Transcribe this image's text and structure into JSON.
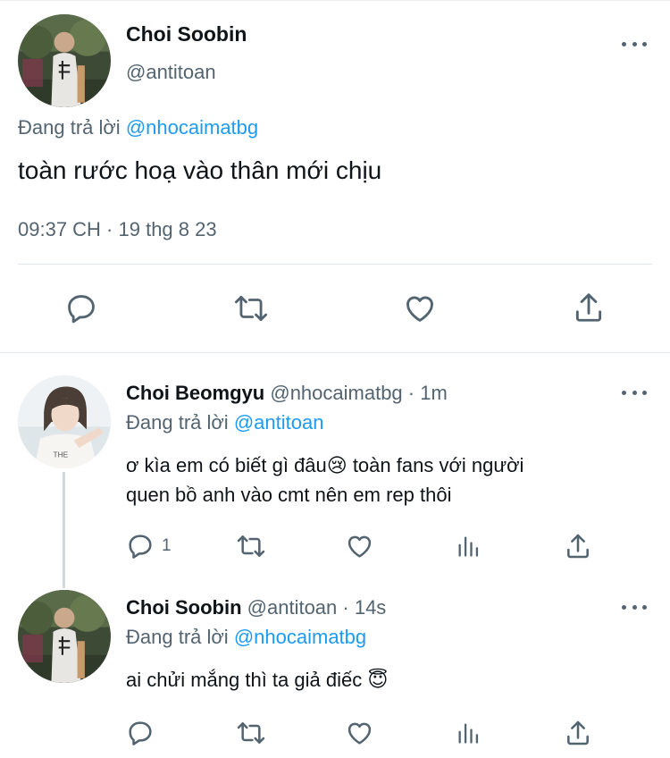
{
  "main_tweet": {
    "author_name": "Choi Soobin",
    "handle": "@antitoan",
    "reply_prefix": "Đang trả lời",
    "reply_to": "@nhocaimatbg",
    "text": "toàn rước hoạ vào thân mới chịu",
    "timestamp": "09:37 CH · 19 thg 8 23"
  },
  "replies": [
    {
      "author_name": "Choi Beomgyu",
      "meta": "@nhocaimatbg · 1m",
      "reply_prefix": "Đang trả lời",
      "reply_to": "@antitoan",
      "text_line1": "ơ kìa em có biết gì đâu😢  toàn fans với người",
      "text_line2": "quen bồ anh vào cmt nên em rep thôi",
      "reply_count": "1"
    },
    {
      "author_name": "Choi Soobin",
      "meta": "@antitoan · 14s",
      "reply_prefix": "Đang trả lời",
      "reply_to": "@nhocaimatbg",
      "text_line1": "ai chửi mắng thì ta giả điếc 😇"
    }
  ],
  "colors": {
    "text": "#0f1419",
    "muted": "#536471",
    "link": "#1d9bf0",
    "divider": "#e1e6ea"
  },
  "icons": [
    "reply-icon",
    "retweet-icon",
    "like-icon",
    "share-icon",
    "views-icon",
    "more-icon"
  ]
}
